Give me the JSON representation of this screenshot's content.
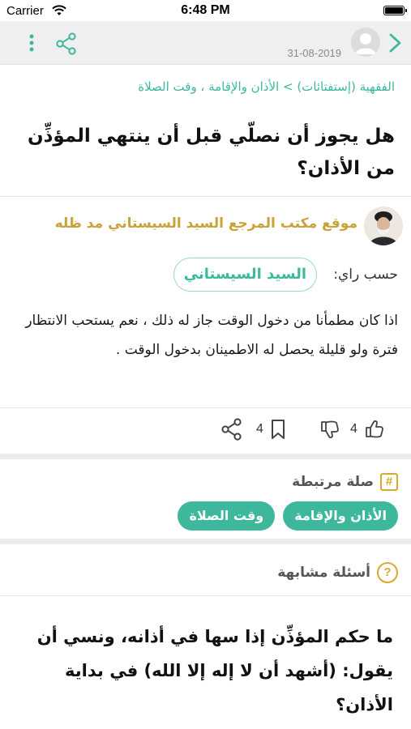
{
  "status_bar": {
    "carrier": "Carrier",
    "time": "6:48 PM",
    "icons": [
      "wifi-icon",
      "battery-icon"
    ]
  },
  "nav": {
    "date": "31-08-2019",
    "icons": [
      "chevron-right-icon",
      "user-avatar-icon",
      "share-icon",
      "more-vertical-icon"
    ]
  },
  "question": {
    "breadcrumb": "الفقهية (إستفتائات) > الأذان والإقامة ، وقت الصلاة",
    "title": "هل يجوز أن نصلّي قبل أن ينتهي المؤذِّن من الأذان؟"
  },
  "author": {
    "name": "موقع مكتب المرجع السيد السيستاني مد ظله"
  },
  "answer": {
    "opinion_label": "حسب راي:",
    "opinion_source": "السيد السيستاني",
    "text": "اذا كان مطمأنا من دخول الوقت جاز له ذلك ، نعم يستحب الانتظار فترة ولو قليلة يحصل له الاطمينان بدخول الوقت ."
  },
  "actions": {
    "bookmark_count": "4",
    "likes_count": "4",
    "icons": [
      "share-icon",
      "bookmark-icon",
      "thumbs-down-icon",
      "thumbs-up-icon"
    ]
  },
  "related": {
    "title": "صلة مرتبطة",
    "tags": [
      "الأذان والإقامة",
      "وقت الصلاة"
    ]
  },
  "similar": {
    "title": "أسئلة مشابهة",
    "first_question": "ما حكم المؤذِّن إذا سها في أذانه، ونسي أن يقول: (أشهد أن لا إله إلا الله) في بداية الأذان؟"
  },
  "colors": {
    "accent": "#3db89c",
    "gold": "#caa23a",
    "icon_gold": "#d9a92c",
    "divider": "#ececec"
  }
}
